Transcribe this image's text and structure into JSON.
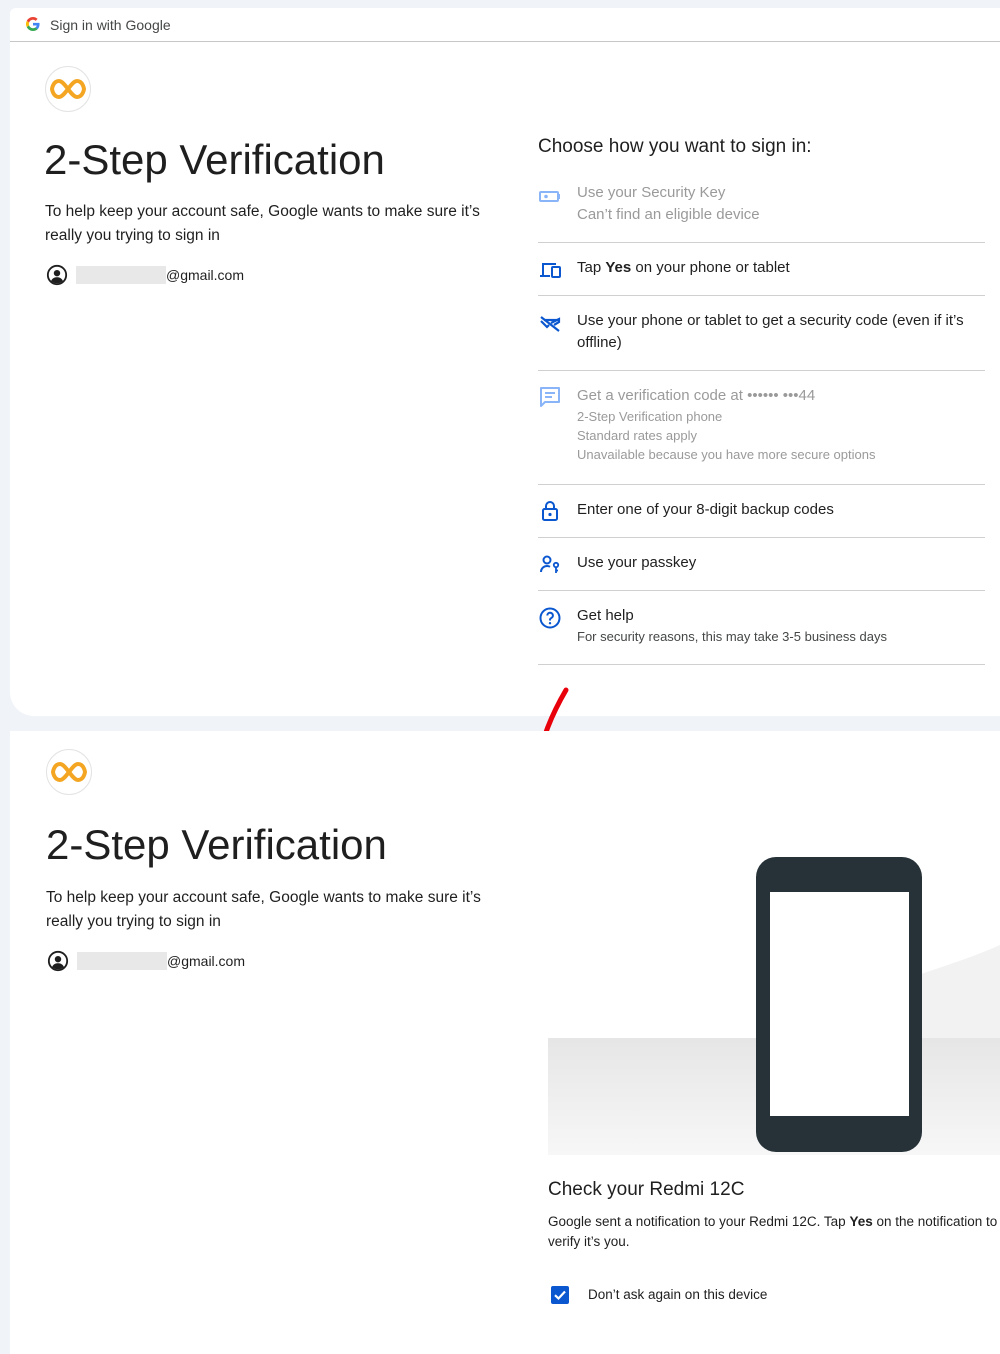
{
  "topbar": {
    "title": "Sign in with Google"
  },
  "panel1": {
    "heading": "2-Step Verification",
    "description": "To help keep your account safe, Google wants to make sure it’s really you trying to sign in",
    "email_suffix": "@gmail.com",
    "choose_title": "Choose how you want to sign in:",
    "options": [
      {
        "icon": "security-key-icon",
        "main": "Use your Security Key",
        "sub": [
          "Can’t find an eligible device"
        ],
        "disabled": true
      },
      {
        "icon": "devices-icon",
        "main_pre": "Tap ",
        "main_bold": "Yes",
        "main_post": " on your phone or tablet",
        "disabled": false
      },
      {
        "icon": "phonelink-off-icon",
        "main": "Use your phone or tablet to get a security code (even if it’s offline)",
        "disabled": false
      },
      {
        "icon": "sms-icon",
        "main": "Get a verification code at •••••• •••44",
        "sub": [
          "2-Step Verification phone",
          "Standard rates apply",
          "Unavailable because you have more secure options"
        ],
        "disabled": true
      },
      {
        "icon": "lock-icon",
        "main": "Enter one of your 8-digit backup codes",
        "disabled": false
      },
      {
        "icon": "passkey-icon",
        "main": "Use your passkey",
        "disabled": false
      },
      {
        "icon": "help-icon",
        "main": "Get help",
        "sub": [
          "For security reasons, this may take 3-5 business days"
        ],
        "disabled": false
      }
    ]
  },
  "panel2": {
    "heading": "2-Step Verification",
    "description": "To help keep your account safe, Google wants to make sure it’s really you trying to sign in",
    "email_suffix": "@gmail.com",
    "check_title": "Check your Redmi 12C",
    "check_desc_pre": "Google sent a notification to your Redmi 12C. Tap ",
    "check_desc_bold": "Yes",
    "check_desc_post": " on the notification to verify it’s you.",
    "checkbox_label": "Don’t ask again on this device",
    "checkbox_checked": true
  },
  "colors": {
    "accent": "#0b57d0",
    "arrow": "#e8000b",
    "logo": "#f4a623"
  }
}
